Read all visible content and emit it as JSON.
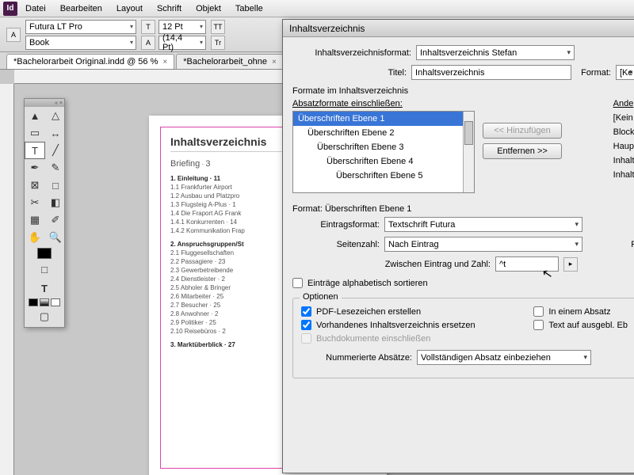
{
  "app_icon": "Id",
  "menu": [
    "Datei",
    "Bearbeiten",
    "Layout",
    "Schrift",
    "Objekt",
    "Tabelle"
  ],
  "control": {
    "font": "Futura LT Pro",
    "style": "Book",
    "size": "12 Pt",
    "leading": "(14,4 Pt)",
    "tt": "TT",
    "tr": "Tr"
  },
  "tabs": [
    {
      "label": "*Bachelorarbeit Original.indd @ 56 %",
      "active": true
    },
    {
      "label": "*Bachelorarbeit_ohne",
      "active": false
    }
  ],
  "page": {
    "title": "Inhaltsverzeichnis",
    "brief": "Briefing",
    "brief_pg": "3",
    "sections": [
      {
        "head": "1. Einleitung · 11",
        "items": [
          "1.1 Frankfurter Airport",
          "1.2 Ausbau und Platzpro",
          "1.3 Flugsteig A-Plus · 1",
          "1.4 Die Fraport AG Frank",
          "1.4.1 Konkurrenten · 14",
          "1.4.2 Kommunikation Frap"
        ]
      },
      {
        "head": "2. Anspruchsgruppen/St",
        "items": [
          "2.1 Fluggesellschaften",
          "2.2 Passagiere · 23",
          "2.3 Gewerbetreibende",
          "2.4 Dienstleister · 2",
          "2.5 Abholer & Bringer",
          "2.6 Mitarbeiter · 25",
          "2.7 Besucher · 25",
          "2.8 Anwohner · 2",
          "2.9 Politiker · 25",
          "2.10 Reisebüros · 2"
        ]
      },
      {
        "head": "3. Marktüberblick · 27",
        "items": []
      }
    ]
  },
  "dialog": {
    "title": "Inhaltsverzeichnis",
    "format_label": "Inhaltsverzeichnisformat:",
    "format_value": "Inhaltsverzeichnis Stefan",
    "titel_label": "Titel:",
    "titel_value": "Inhaltsverzeichnis",
    "format2_label": "Format:",
    "format2_value": "[Ke",
    "section_formats": "Formate im Inhaltsverzeichnis",
    "absatz_label": "Absatzformate einschließen:",
    "andere_label": "Ande",
    "list": [
      "Überschriften Ebene 1",
      "Überschriften Ebene 2",
      "Überschriften Ebene 3",
      "Überschriften Ebene 4",
      "Überschriften Ebene 5"
    ],
    "other_list": [
      "[Kein",
      "Block",
      "Haupt",
      "Inhalt",
      "Inhalt"
    ],
    "btn_add": "<< Hinzufügen",
    "btn_remove": "Entfernen >>",
    "format_head": "Format: Überschriften Ebene 1",
    "eintrag_label": "Eintragsformat:",
    "eintrag_value": "Textschrift Futura",
    "seiten_label": "Seitenzahl:",
    "seiten_value": "Nach Eintrag",
    "zwischen_label": "Zwischen Eintrag und Zahl:",
    "zwischen_value": "^t",
    "alpha_sort": "Einträge alphabetisch sortieren",
    "group_opt": "Optionen",
    "chk_pdf": "PDF-Lesezeichen erstellen",
    "chk_replace": "Vorhandenes Inhaltsverzeichnis ersetzen",
    "chk_book": "Buchdokumente einschließen",
    "chk_absatz": "In einem Absatz",
    "chk_text_ausg": "Text auf ausgebl. Eb",
    "num_label": "Nummerierte Absätze:",
    "num_value": "Vollständigen Absatz einbeziehen",
    "right_f": "F"
  }
}
